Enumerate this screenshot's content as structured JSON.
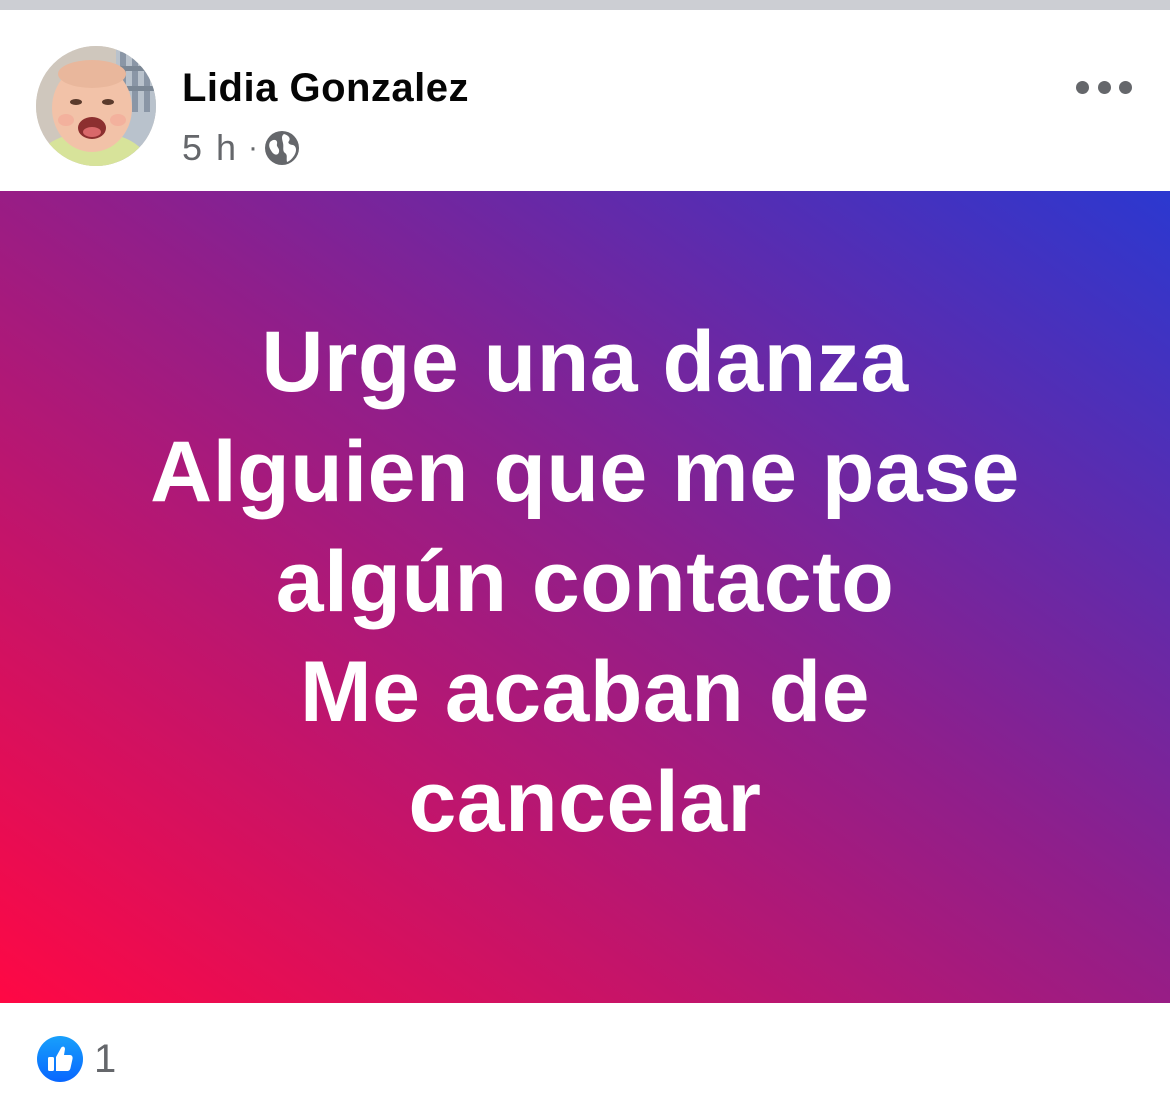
{
  "post": {
    "author": "Lidia Gonzalez",
    "time": "5 h",
    "separator": "·",
    "audience_icon": "globe-icon",
    "more_icon": "more-options-icon",
    "text_lines": [
      "Urge una danza",
      "Alguien que me pase",
      "algún contacto",
      "Me acaban de",
      "cancelar"
    ],
    "background": {
      "gradient_start": "#ff0844",
      "gradient_mid": "#8e1f8c",
      "gradient_end": "#2b38d0"
    },
    "reactions": {
      "icon": "like-icon",
      "count": "1",
      "color": "#1877f2"
    }
  }
}
